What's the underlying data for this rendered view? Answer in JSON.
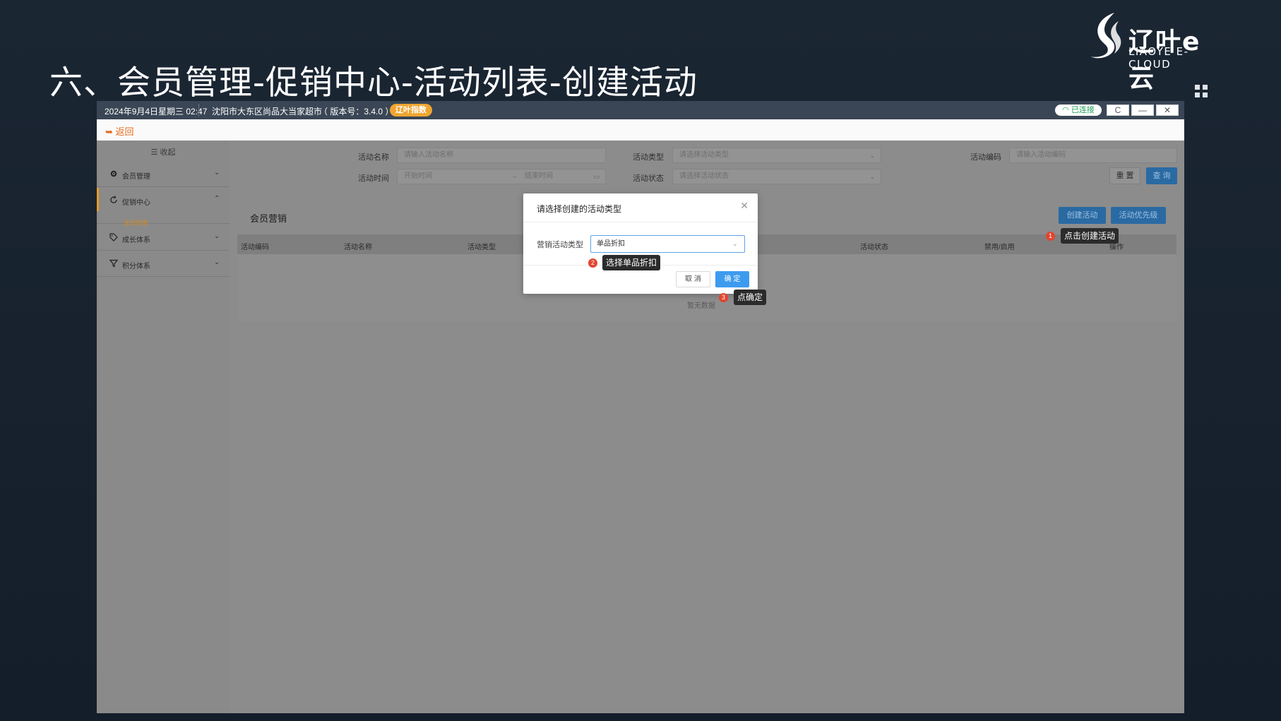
{
  "slide": {
    "title": "六、会员管理-促销中心-活动列表-创建活动",
    "logo_text": "辽叶e云",
    "logo_sub": "LIAOYE E-CLOUD"
  },
  "titlebar": {
    "datetime": "2024年9月4日星期三 02:47",
    "store": "沈阳市大东区尚品大当家超市",
    "version": "（ 版本号：3.4.0 ）",
    "badge": "辽叶指数",
    "connection": "已连接",
    "refresh": "C",
    "minimize": "—",
    "close": "✕"
  },
  "backbar": {
    "back_label": "返回"
  },
  "sidebar": {
    "collapse_label": "☰ 收起",
    "items": [
      {
        "label": "会员管理",
        "icon": "gear-icon"
      },
      {
        "label": "促销中心",
        "icon": "refresh-icon"
      },
      {
        "label": "成长体系",
        "icon": "tag-icon"
      },
      {
        "label": "积分体系",
        "icon": "filter-icon"
      }
    ],
    "sub_item": "活动列表"
  },
  "filters": {
    "name_label": "活动名称",
    "name_placeholder": "请输入活动名称",
    "type_label": "活动类型",
    "type_placeholder": "请选择活动类型",
    "code_label": "活动编码",
    "code_placeholder": "请输入活动编码",
    "time_label": "活动时间",
    "start_placeholder": "开始时间",
    "end_placeholder": "结束时间",
    "status_label": "活动状态",
    "status_placeholder": "请选择活动状态",
    "reset": "重 置",
    "query": "查 询"
  },
  "main": {
    "section_title": "会员营销",
    "create_btn": "创建活动",
    "priority_btn": "活动优先级",
    "columns": [
      "活动编码",
      "活动名称",
      "活动类型",
      "活动状态",
      "禁用/启用",
      "操作"
    ],
    "empty_text": "暂无数据"
  },
  "dialog": {
    "title": "请选择创建的活动类型",
    "field_label": "营销活动类型",
    "selected_value": "单品折扣",
    "cancel": "取 消",
    "ok": "确 定"
  },
  "annotations": [
    {
      "num": "1",
      "text": "点击创建活动"
    },
    {
      "num": "2",
      "text": "选择单品折扣"
    },
    {
      "num": "3",
      "text": "点确定"
    }
  ]
}
